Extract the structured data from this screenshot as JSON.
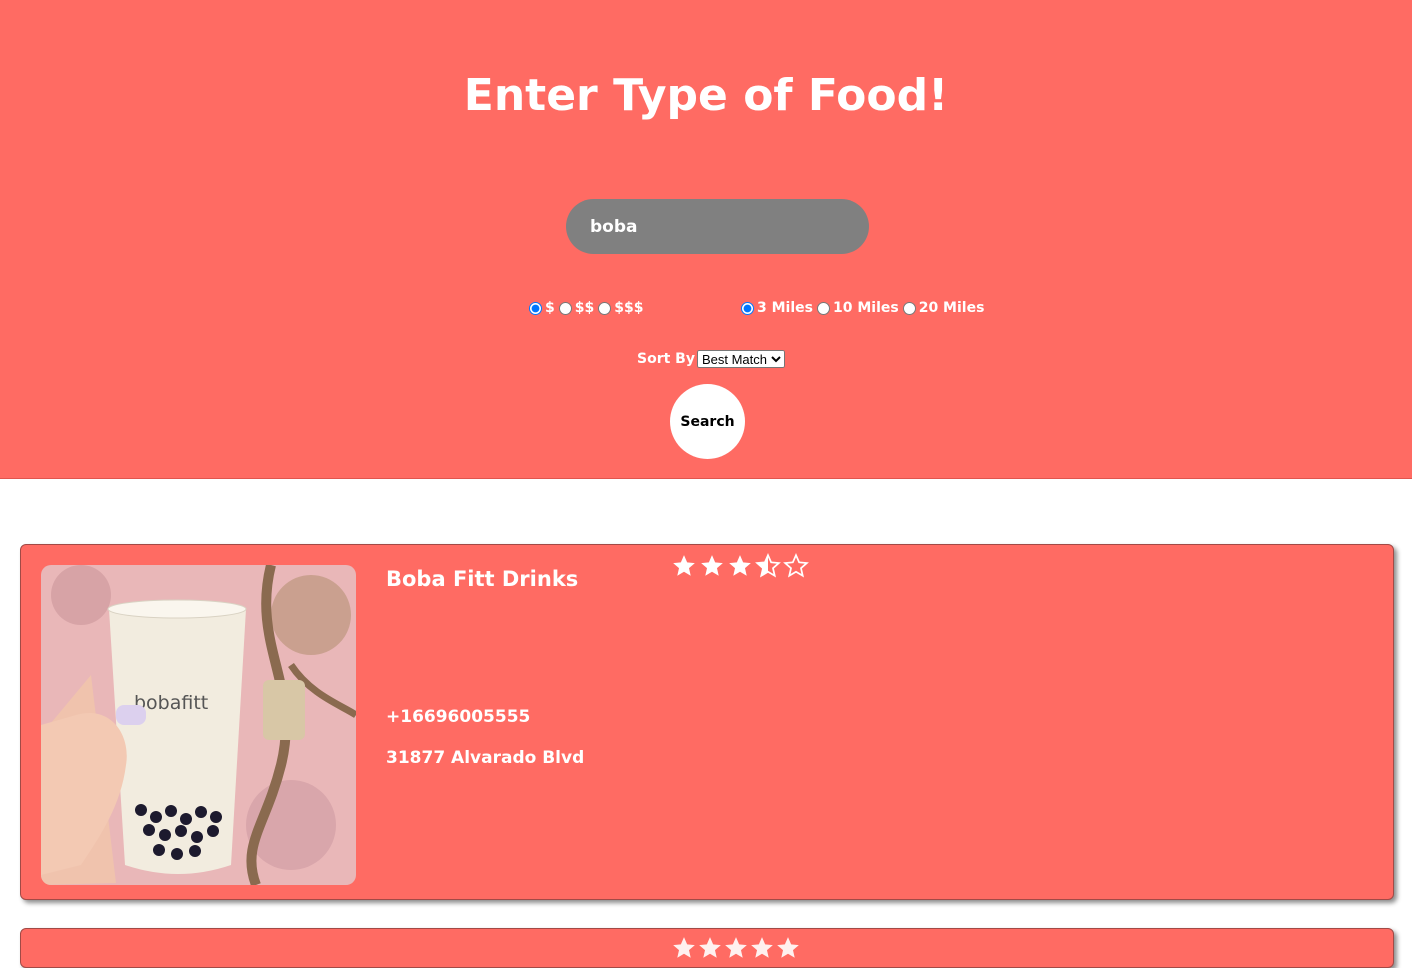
{
  "header": {
    "title": "Enter Type of Food!",
    "search_value": "boba",
    "price_options": [
      "$",
      "$$",
      "$$$"
    ],
    "price_selected": "$",
    "distance_options": [
      "3 Miles",
      "10 Miles",
      "20 Miles"
    ],
    "distance_selected": "3 Miles",
    "sort_label": "Sort By",
    "sort_value": "Best Match",
    "search_button": "Search"
  },
  "results": [
    {
      "name": "Boba Fitt Drinks",
      "rating": 3.5,
      "rating_max": 5,
      "phone": "+16696005555",
      "address": "31877 Alvarado Blvd",
      "photo_text": "bobafitt"
    }
  ],
  "colors": {
    "accent": "#ff6b63",
    "input_bg": "#808080",
    "text": "#ffffff"
  }
}
